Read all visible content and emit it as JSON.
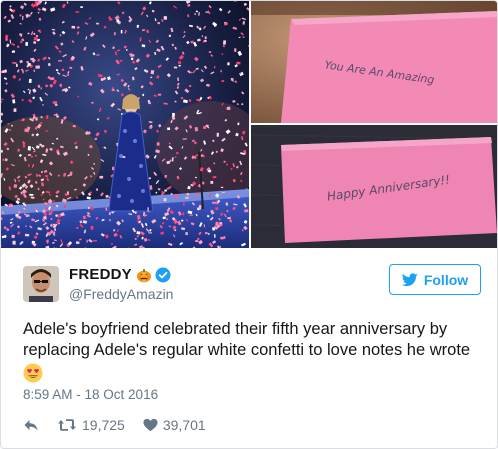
{
  "tweet": {
    "display_name": "FREDDY",
    "handle": "@FreddyAmazin",
    "follow_label": "Follow",
    "text_line1": "Adele's boyfriend celebrated their fifth year anniversary by",
    "text_line2": "replacing Adele's regular white confetti to love notes he wrote",
    "emoji": "heart-eyes-emoji",
    "timestamp": "8:59 AM - 18 Oct 2016",
    "retweets": "19,725",
    "likes": "39,701"
  },
  "media": {
    "note1_text": "You Are An Amazing",
    "note2_text": "Happy Anniversary!!"
  },
  "icons": {
    "pumpkin": "pumpkin-icon",
    "verified": "verified-badge-icon",
    "bird": "twitter-bird-icon",
    "reply": "reply-icon",
    "retweet": "retweet-icon",
    "like": "heart-icon"
  },
  "colors": {
    "accent": "#1da1f2",
    "text": "#14171a",
    "muted": "#657786",
    "note_pink": "#f07fb0"
  }
}
